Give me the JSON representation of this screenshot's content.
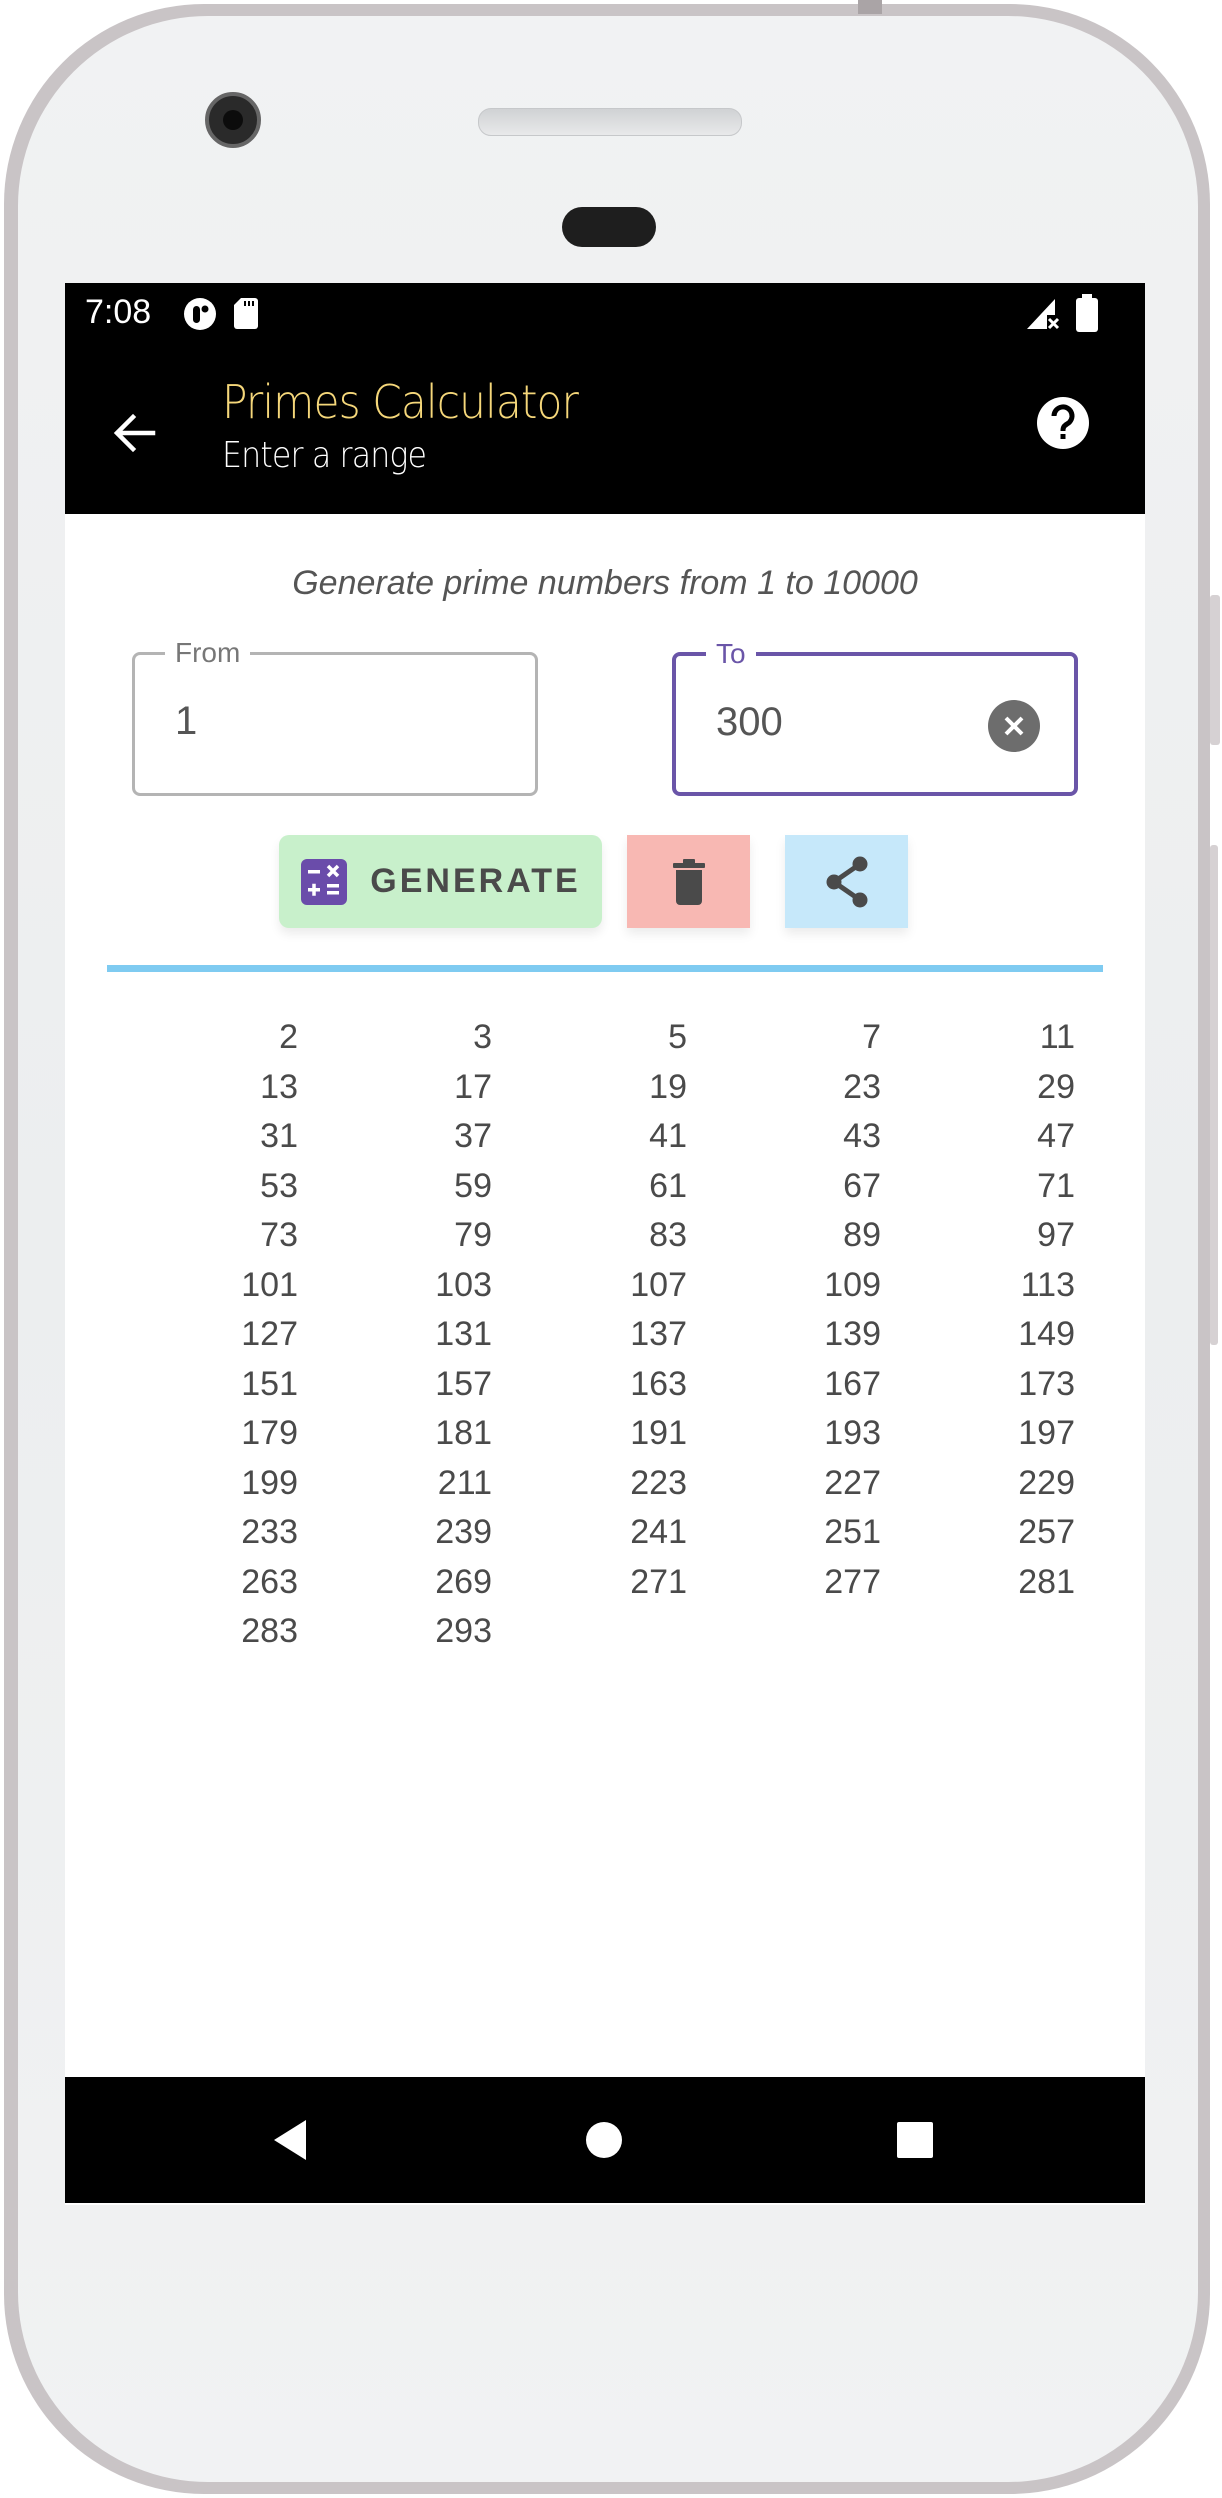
{
  "status_bar": {
    "time": "7:08",
    "icons": [
      "data-saver-icon",
      "sd-card-icon",
      "no-signal-icon",
      "battery-icon"
    ]
  },
  "app_bar": {
    "title": "Primes Calculator",
    "subtitle": "Enter a range",
    "back_icon": "arrow-back-icon",
    "help_icon": "help-circle-icon",
    "title_color": "#f5d77a"
  },
  "main": {
    "info_text": "Generate prime numbers from 1 to 10000",
    "from_field": {
      "label": "From",
      "value": "1"
    },
    "to_field": {
      "label": "To",
      "value": "300",
      "clear_icon": "clear-circle-icon"
    },
    "buttons": {
      "generate_label": "GENERATE",
      "generate_icon": "calculator-icon",
      "delete_icon": "trash-icon",
      "share_icon": "share-icon"
    },
    "accent_color": "#6a55a8",
    "divider_color": "#7fcbf1",
    "columns": 5,
    "primes": [
      "2",
      "3",
      "5",
      "7",
      "11",
      "13",
      "17",
      "19",
      "23",
      "29",
      "31",
      "37",
      "41",
      "43",
      "47",
      "53",
      "59",
      "61",
      "67",
      "71",
      "73",
      "79",
      "83",
      "89",
      "97",
      "101",
      "103",
      "107",
      "109",
      "113",
      "127",
      "131",
      "137",
      "139",
      "149",
      "151",
      "157",
      "163",
      "167",
      "173",
      "179",
      "181",
      "191",
      "193",
      "197",
      "199",
      "211",
      "223",
      "227",
      "229",
      "233",
      "239",
      "241",
      "251",
      "257",
      "263",
      "269",
      "271",
      "277",
      "281",
      "283",
      "293"
    ]
  },
  "nav_bar": {
    "icons": [
      "nav-back-icon",
      "nav-home-icon",
      "nav-recents-icon"
    ]
  }
}
